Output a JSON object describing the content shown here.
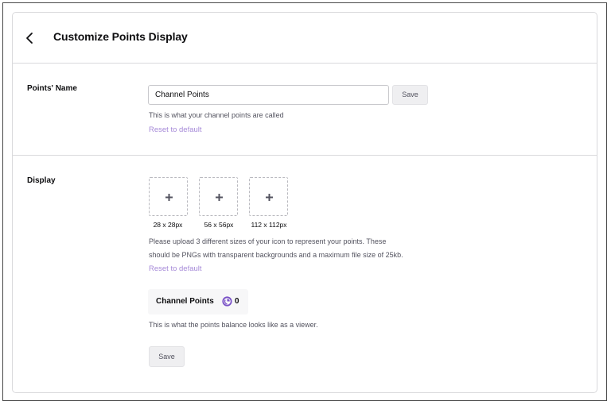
{
  "header": {
    "title": "Customize Points Display",
    "back_icon": "chevron-left-icon"
  },
  "points_name": {
    "label": "Points' Name",
    "input_value": "Channel Points",
    "save_label": "Save",
    "help_text": "This is what your channel points are called",
    "reset_label": "Reset to default"
  },
  "display": {
    "label": "Display",
    "upload_icon": "plus-icon",
    "sizes": [
      "28 x 28px",
      "56 x 56px",
      "112 x 112px"
    ],
    "help_line1": "Please upload 3 different sizes of your icon to represent your points. These",
    "help_line2": "should be PNGs with transparent backgrounds and a maximum file size of 25kb.",
    "reset_label": "Reset to default",
    "preview": {
      "label": "Channel Points",
      "icon": "channel-points-icon",
      "value": "0"
    },
    "preview_help": "This is what the points balance looks like as a viewer.",
    "save_label": "Save"
  },
  "colors": {
    "accent": "#a68ad8",
    "points_icon": "#7a52c7"
  }
}
